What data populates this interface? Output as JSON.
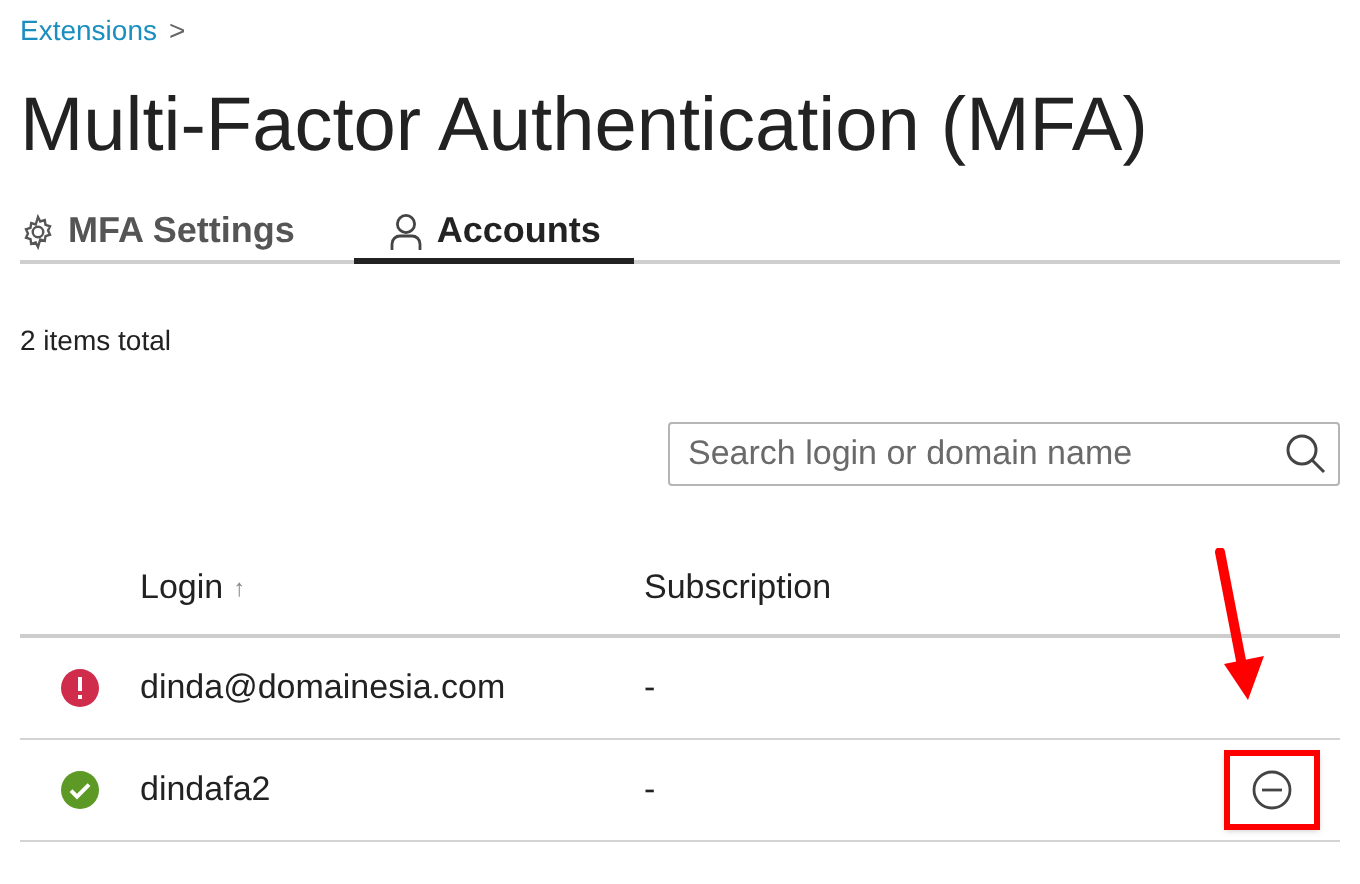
{
  "breadcrumb": {
    "label": "Extensions",
    "separator": ">"
  },
  "title": "Multi-Factor Authentication (MFA)",
  "tabs": [
    {
      "label": "MFA Settings",
      "kind": "gear",
      "selected": false
    },
    {
      "label": "Accounts",
      "kind": "user",
      "selected": true
    }
  ],
  "items_total": "2 items total",
  "search": {
    "placeholder": "Search login or domain name"
  },
  "table": {
    "columns": [
      {
        "label": "Login",
        "sort": "↑"
      },
      {
        "label": "Subscription"
      }
    ],
    "rows": [
      {
        "kind": "error",
        "login": "dinda@domainesia.com",
        "subscription": "-",
        "remove_button": false,
        "highlighted": false
      },
      {
        "kind": "ok",
        "login": "dindafa2",
        "subscription": "-",
        "remove_button": true,
        "highlighted": true
      }
    ]
  }
}
